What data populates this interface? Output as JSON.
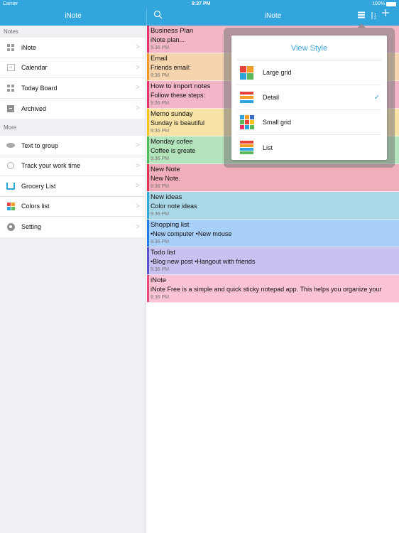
{
  "status_bar": {
    "carrier": "Carrier",
    "time": "9:37 PM",
    "battery": "100%"
  },
  "left_nav": {
    "title": "iNote"
  },
  "right_nav": {
    "title": "iNote",
    "icons": [
      "search-icon",
      "view-style-icon",
      "sort-icon",
      "add-icon"
    ]
  },
  "sidebar": {
    "notes_header": "Notes",
    "notes_items": [
      {
        "label": "iNote",
        "icon": "grid-icon"
      },
      {
        "label": "Calendar",
        "icon": "calendar-icon"
      },
      {
        "label": "Today Board",
        "icon": "grid-icon"
      },
      {
        "label": "Archived",
        "icon": "archive-icon"
      }
    ],
    "more_header": "More",
    "more_items": [
      {
        "label": "Text to group",
        "icon": "chat-bubble-icon"
      },
      {
        "label": "Track your work time",
        "icon": "stopwatch-icon"
      },
      {
        "label": "Grocery List",
        "icon": "cart-icon"
      },
      {
        "label": "Colors list",
        "icon": "colors-icon"
      },
      {
        "label": "Setting",
        "icon": "gear-icon"
      }
    ]
  },
  "notes": [
    {
      "title": "Business Plan",
      "body": "iNote plan...",
      "time": "9:36 PM",
      "bg": "#f3b6c6",
      "bar": "#e8336a"
    },
    {
      "title": "Email",
      "body": "Friends email:",
      "time": "9:36 PM",
      "bg": "#f6d4ad",
      "bar": "#f3962a"
    },
    {
      "title": "How to import notes",
      "body": "Follow these steps:",
      "time": "9:36 PM",
      "bg": "#f3b6c9",
      "bar": "#e8336a"
    },
    {
      "title": "Memo sunday",
      "body": "Sunday is beautiful",
      "time": "9:36 PM",
      "bg": "#f8e3a6",
      "bar": "#f6c21c"
    },
    {
      "title": "Monday cofee",
      "body": "Coffee is greate",
      "time": "9:36 PM",
      "bg": "#b4e4bb",
      "bar": "#4cbf58"
    },
    {
      "title": "New Note",
      "body": "New Note.",
      "time": "9:36 PM",
      "bg": "#f0adba",
      "bar": "#e33355"
    },
    {
      "title": "New ideas",
      "body": "Color note ideas",
      "time": "9:36 PM",
      "bg": "#aad8e7",
      "bar": "#2ea8d8"
    },
    {
      "title": "Shopping list",
      "body": "•New computer •New mouse",
      "time": "9:36 PM",
      "bg": "#a8cff7",
      "bar": "#1f7ae6"
    },
    {
      "title": "Todo list",
      "body": "•Blog new post •Hangout with friends",
      "time": "9:36 PM",
      "bg": "#c8c2f0",
      "bar": "#5752cf"
    },
    {
      "title": "iNote",
      "body": "iNote Free is a simple and quick sticky notepad app. This  helps you organize your",
      "time": "9:36 PM",
      "bg": "#fbc3d3",
      "bar": "#ea4b7d"
    }
  ],
  "view_style_popover": {
    "title": "View Style",
    "options": [
      {
        "label": "Large grid",
        "icon": "large-grid-icon",
        "selected": false
      },
      {
        "label": "Detail",
        "icon": "detail-icon",
        "selected": true
      },
      {
        "label": "Small grid",
        "icon": "small-grid-icon",
        "selected": false
      },
      {
        "label": "List",
        "icon": "list-icon",
        "selected": false
      }
    ],
    "checkmark": "✓"
  },
  "colors": {
    "accent": "#31a5dc",
    "popover_title": "#3aa5dc"
  }
}
